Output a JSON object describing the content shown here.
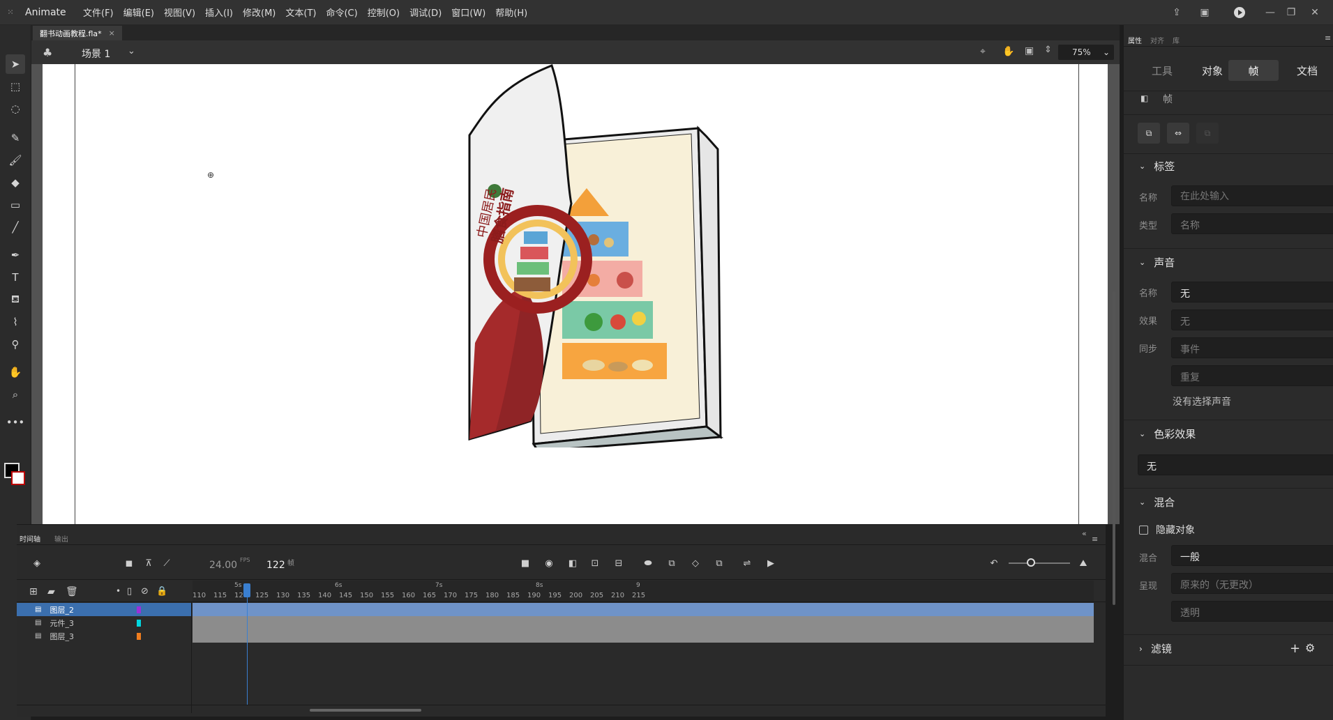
{
  "app": {
    "name": "Animate"
  },
  "menu": [
    "文件(F)",
    "编辑(E)",
    "视图(V)",
    "插入(I)",
    "修改(M)",
    "文本(T)",
    "命令(C)",
    "控制(O)",
    "调试(D)",
    "窗口(W)",
    "帮助(H)"
  ],
  "document": {
    "tab_title": "翻书动画教程.fla*",
    "tab_close": "×"
  },
  "scene": {
    "name": "场景 1",
    "zoom": "75%"
  },
  "book": {
    "cover_line1": "中国居民",
    "cover_line2": "膳食指南"
  },
  "timeline": {
    "tabs": [
      "时间轴",
      "输出"
    ],
    "fps": "24.00",
    "fps_unit": "FPS",
    "frame": "122",
    "frame_unit": "帧",
    "seconds_marks": [
      "5s",
      "6s",
      "7s",
      "8s",
      "9"
    ],
    "frame_ticks": [
      "110",
      "115",
      "120",
      "125",
      "130",
      "135",
      "140",
      "145",
      "150",
      "155",
      "160",
      "165",
      "170",
      "175",
      "180",
      "185",
      "190",
      "195",
      "200",
      "205",
      "210",
      "215"
    ],
    "playhead_frame": 122,
    "layers": [
      {
        "name": "图层_2",
        "color": "#9b30d9",
        "selected": true
      },
      {
        "name": "元件_3",
        "color": "#00d7e0",
        "selected": false
      },
      {
        "name": "图层_3",
        "color": "#f07d1e",
        "selected": false
      }
    ]
  },
  "properties": {
    "panel_tabs": [
      "属性",
      "对齐",
      "库"
    ],
    "tabs": [
      "工具",
      "对象",
      "帧",
      "文档"
    ],
    "active_tab": "帧",
    "frame_label": "帧",
    "label_section": {
      "title": "标签",
      "name_label": "名称",
      "name_placeholder": "在此处输入",
      "type_label": "类型",
      "type_value": "名称"
    },
    "sound_section": {
      "title": "声音",
      "name_label": "名称",
      "name_value": "无",
      "effect_label": "效果",
      "effect_value": "无",
      "sync_label": "同步",
      "sync_value": "事件",
      "repeat_value": "重复",
      "no_sound": "没有选择声音"
    },
    "color_section": {
      "title": "色彩效果",
      "value": "无"
    },
    "blend_section": {
      "title": "混合",
      "hide_objects": "隐藏对象",
      "blend_label": "混合",
      "blend_value": "一般",
      "render_label": "呈现",
      "render_value": "原来的（无更改）",
      "transparent_value": "透明"
    },
    "filter_section": {
      "title": "滤镜"
    }
  }
}
